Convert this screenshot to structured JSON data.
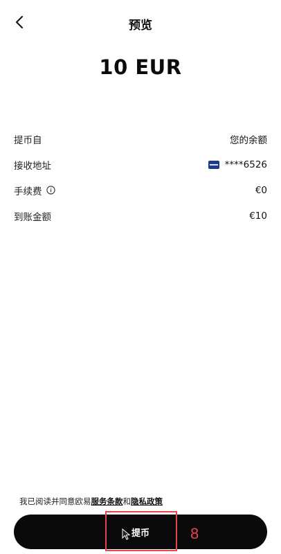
{
  "header": {
    "back_icon": "chevron-left-icon",
    "title": "预览"
  },
  "amount": "10 EUR",
  "details": [
    {
      "label": "提币自",
      "value": "您的余额"
    },
    {
      "label": "接收地址",
      "value": "****6526",
      "icon": "card-icon"
    },
    {
      "label": "手续费",
      "value": "€0",
      "info_icon": "info-icon"
    },
    {
      "label": "到账金额",
      "value": "€10"
    }
  ],
  "terms": {
    "prefix": "我已阅读并同意欧易",
    "link1": "服务条款",
    "conjunction": "和",
    "link2": "隐私政策"
  },
  "submit": {
    "label": "提币"
  },
  "annotation": {
    "number": "8",
    "color": "#e8444a"
  },
  "colors": {
    "button_bg": "#0a0a0a",
    "card_blue": "#1f3b8f"
  }
}
